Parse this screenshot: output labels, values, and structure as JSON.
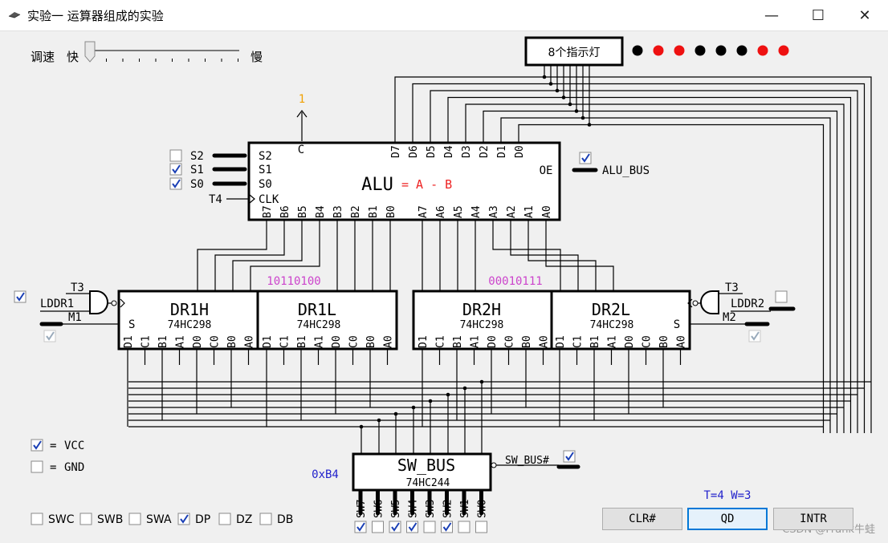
{
  "window": {
    "title": "实验一 运算器组成的实验",
    "minimize": "—",
    "maximize": "☐",
    "close": "✕"
  },
  "speed": {
    "label": "调速",
    "fast": "快",
    "slow": "慢",
    "value": 0.0
  },
  "indicator": {
    "label": "8个指示灯",
    "lights": [
      "#000000",
      "#ee1111",
      "#ee1111",
      "#000000",
      "#000000",
      "#000000",
      "#ee1111",
      "#ee1111"
    ]
  },
  "alu": {
    "title": "ALU",
    "expr": "= A - B",
    "c_label": "C",
    "c_value": "1",
    "oe": "OE",
    "bus_label": "ALU_BUS",
    "s2": "S2",
    "s1": "S1",
    "s0": "S0",
    "clk": "CLK",
    "t4": "T4",
    "d_pins": [
      "D7",
      "D6",
      "D5",
      "D4",
      "D3",
      "D2",
      "D1",
      "D0"
    ],
    "b_pins": [
      "B7",
      "B6",
      "B5",
      "B4",
      "B3",
      "B2",
      "B1",
      "B0"
    ],
    "a_pins": [
      "A7",
      "A6",
      "A5",
      "A4",
      "A3",
      "A2",
      "A1",
      "A0"
    ],
    "s2_checked": false,
    "s1_checked": true,
    "s0_checked": true,
    "oe_checked": true
  },
  "dr1": {
    "value": "10110100",
    "h_name": "DR1H",
    "l_name": "DR1L",
    "chip": "74HC298",
    "t3": "T3",
    "lddr": "LDDR1",
    "m": "M1",
    "s": "S",
    "lddr_checked": true,
    "m_checked": true
  },
  "dr2": {
    "value": "00010111",
    "h_name": "DR2H",
    "l_name": "DR2L",
    "chip": "74HC298",
    "t3": "T3",
    "lddr": "LDDR2",
    "m": "M2",
    "s": "S",
    "lddr_checked": false,
    "m_checked": true
  },
  "reg_pins": [
    "D1",
    "C1",
    "B1",
    "A1",
    "D0",
    "C0",
    "B0",
    "A0"
  ],
  "sw_bus": {
    "name": "SW_BUS",
    "chip": "74HC244",
    "hex": "0xB4",
    "enable_label": "SW_BUS#",
    "enable_checked": true,
    "pins": [
      "SW7",
      "SW6",
      "SW5",
      "SW4",
      "SW3",
      "SW2",
      "SW1",
      "SW0"
    ],
    "switches": [
      true,
      false,
      true,
      true,
      false,
      true,
      false,
      false
    ]
  },
  "power": {
    "vcc": "VCC",
    "gnd": "GND",
    "eq": "=",
    "vcc_checked": true,
    "gnd_checked": false
  },
  "modes": [
    {
      "label": "SWC",
      "checked": false
    },
    {
      "label": "SWB",
      "checked": false
    },
    {
      "label": "SWA",
      "checked": false
    },
    {
      "label": "DP",
      "checked": true
    },
    {
      "label": "DZ",
      "checked": false
    },
    {
      "label": "DB",
      "checked": false
    }
  ],
  "timing": "T=4 W=3",
  "buttons": {
    "clr": "CLR#",
    "qd": "QD",
    "intr": "INTR"
  },
  "watermark": "CSDN @Frank牛蛙",
  "colors": {
    "red_text": "#ee2222",
    "purple": "#cc44cc",
    "blue": "#2222cc",
    "orange": "#f0a000",
    "check": "#1a3fb5"
  }
}
